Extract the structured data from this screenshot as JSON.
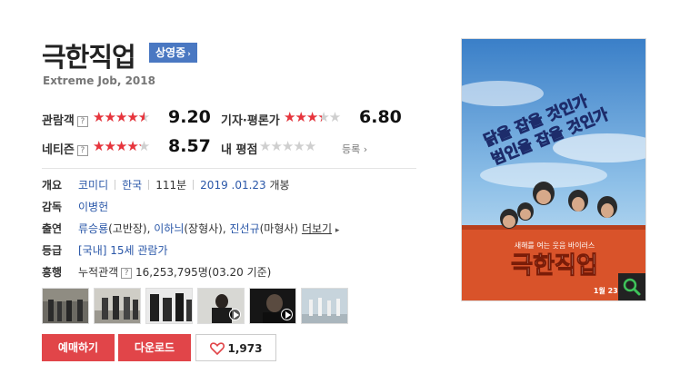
{
  "movie": {
    "title": "극한직업",
    "status_badge": "상영중",
    "subtitle": "Extreme Job, 2018"
  },
  "ratings": {
    "audience": {
      "label": "관람객",
      "help": "?",
      "score": "9.20",
      "value": 9.2,
      "max": 10
    },
    "critic": {
      "label": "기자·평론가",
      "score": "6.80",
      "value": 6.8,
      "max": 10
    },
    "netizen": {
      "label": "네티즌",
      "help": "?",
      "score": "8.57",
      "value": 8.57,
      "max": 10
    },
    "my_rating": {
      "label": "내 평점",
      "value": 0,
      "max": 10,
      "register": "등록"
    }
  },
  "info": {
    "overview": {
      "label": "개요",
      "genre": "코미디",
      "country": "한국",
      "runtime": "111분",
      "release_date": "2019 .01.23",
      "release_suffix": " 개봉"
    },
    "director": {
      "label": "감독",
      "name": "이병헌"
    },
    "cast": {
      "label": "출연",
      "members": [
        {
          "name": "류승룡",
          "role": "(고반장), "
        },
        {
          "name": "이하늬",
          "role": "(장형사), "
        },
        {
          "name": "진선규",
          "role": "(마형사) "
        }
      ],
      "more": "더보기"
    },
    "grade": {
      "label": "등급",
      "text": "[국내] 15세 관람가"
    },
    "box_office": {
      "label": "흥행",
      "text_label": "누적관객",
      "help": "?",
      "value": "16,253,795명(03.20 기준)"
    }
  },
  "thumbnails": [
    {
      "kind": "photo",
      "icon": ""
    },
    {
      "kind": "photo",
      "icon": ""
    },
    {
      "kind": "photo",
      "icon": ""
    },
    {
      "kind": "video",
      "icon": "play-icon"
    },
    {
      "kind": "video",
      "icon": "play-icon"
    },
    {
      "kind": "photo",
      "icon": ""
    }
  ],
  "actions": {
    "reserve": "예매하기",
    "download": "다운로드",
    "like_count": "1,973"
  },
  "poster": {
    "tagline": "닭을 잡을 것인가 범인을 잡을 것인가",
    "copy": "새해를 여는 웃음 바이러스",
    "title": "극한직업",
    "date": "1월 23일"
  },
  "colors": {
    "accent_red": "#e14549",
    "star_red": "#e8343c",
    "link_blue": "#2a57a8",
    "badge_blue": "#4a78c2"
  }
}
